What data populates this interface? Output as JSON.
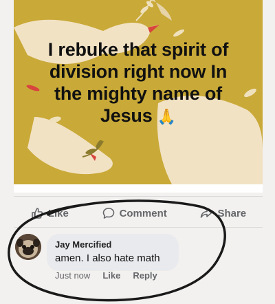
{
  "post": {
    "text_line1": "I rebuke that spirit of",
    "text_line2": "division right now In",
    "text_line3": "the mighty name of",
    "text_line4": "Jesus",
    "emoji": "🙏",
    "background_color": "#c9a938",
    "dove_color": "#f2e2c4",
    "beak_color": "#d8453d"
  },
  "actions": {
    "like": "Like",
    "comment": "Comment",
    "share": "Share"
  },
  "comment": {
    "author": "Jay Mercified",
    "text": "amen. I also hate math",
    "time": "Just now",
    "like": "Like",
    "reply": "Reply"
  },
  "annotation": {
    "marker_color": "#1a1a1a"
  }
}
